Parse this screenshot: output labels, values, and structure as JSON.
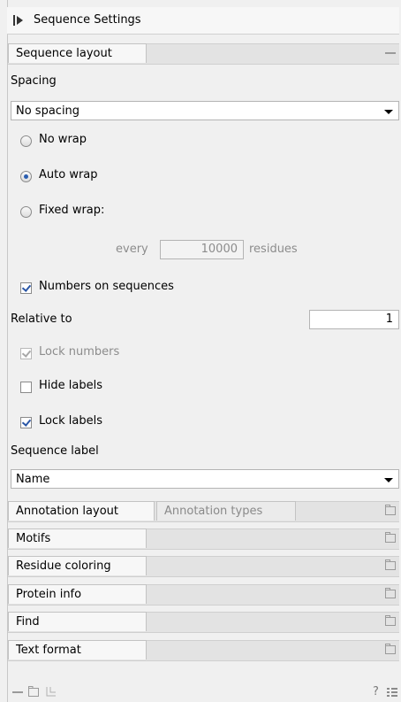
{
  "header": {
    "title": "Sequence Settings"
  },
  "sequence_layout": {
    "tab_label": "Sequence layout",
    "spacing_label": "Spacing",
    "spacing_value": "No spacing",
    "radio_no_wrap": "No wrap",
    "radio_auto_wrap": "Auto wrap",
    "radio_fixed_wrap": "Fixed wrap:",
    "selected_wrap": "Auto wrap",
    "every_label": "every",
    "every_value": "10000",
    "residues_label": "residues",
    "numbers_on_sequences": "Numbers on sequences",
    "relative_to_label": "Relative to",
    "relative_to_value": "1",
    "lock_numbers": "Lock numbers",
    "hide_labels": "Hide labels",
    "lock_labels": "Lock labels",
    "sequence_label_label": "Sequence label",
    "sequence_label_value": "Name"
  },
  "sections": {
    "annotation_layout": "Annotation layout",
    "annotation_types": "Annotation types",
    "motifs": "Motifs",
    "residue_coloring": "Residue coloring",
    "protein_info": "Protein info",
    "find": "Find",
    "text_format": "Text format"
  },
  "footer": {
    "help": "?"
  }
}
